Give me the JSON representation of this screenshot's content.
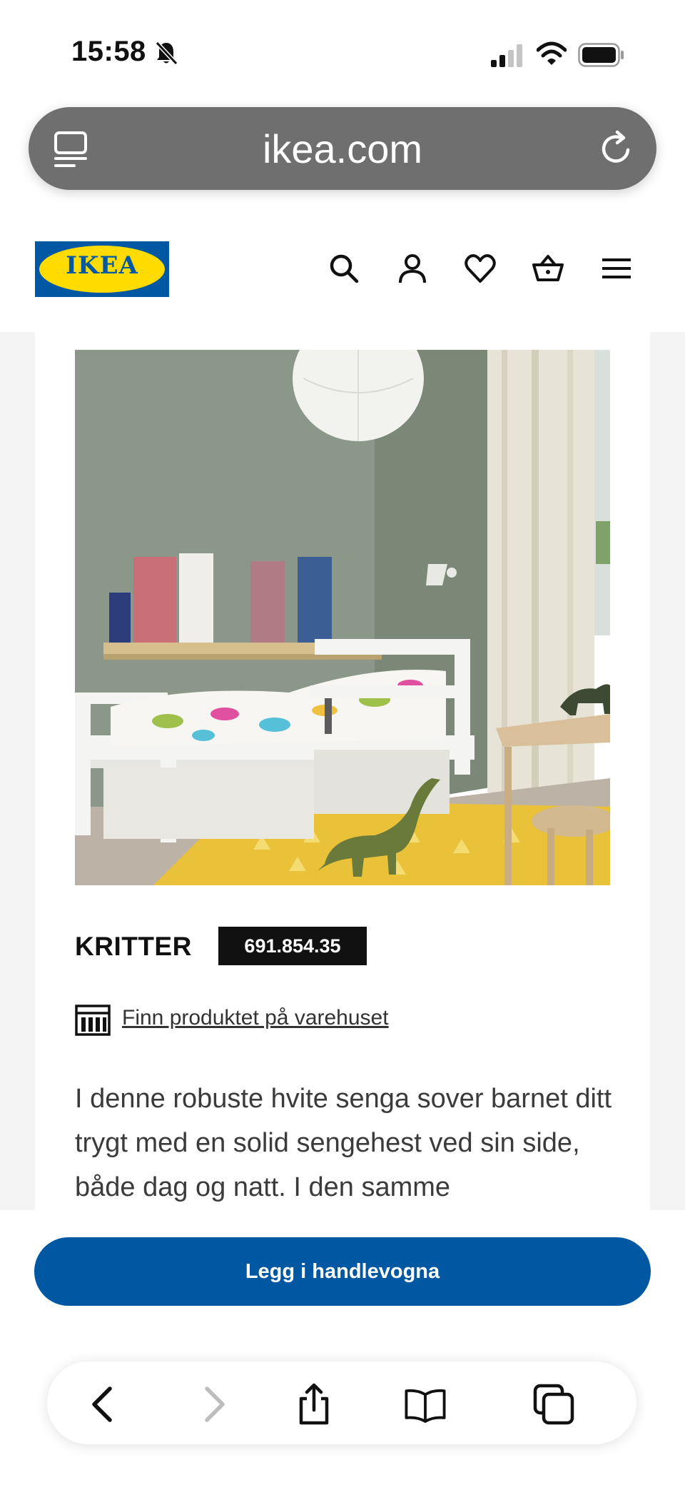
{
  "status_bar": {
    "time": "15:58"
  },
  "browser": {
    "url": "ikea.com"
  },
  "site_header": {
    "logo_text": "IKEA"
  },
  "product": {
    "name": "KRITTER",
    "article_number": "691.854.35",
    "store_link": "Finn produktet på varehuset",
    "description": "I denne robuste hvite senga sover barnet ditt trygt med en solid sengehest ved sin side, både dag og natt. I den samme"
  },
  "cta": {
    "add_to_cart": "Legg i handlevogna"
  },
  "colors": {
    "ikea_blue": "#0058a3",
    "ikea_yellow": "#ffdb00",
    "url_bar": "#6f6f6f"
  }
}
